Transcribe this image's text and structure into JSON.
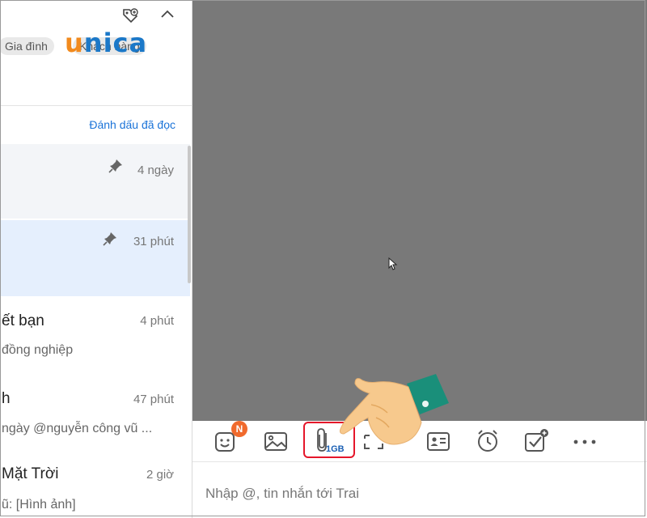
{
  "sidebar": {
    "chips": [
      "Gia đình",
      "Khách hàng"
    ],
    "logo_brand": "unica",
    "mark_read_label": "Đánh dấu đã đọc",
    "conversations": [
      {
        "name": "",
        "preview": "",
        "time": "4 ngày",
        "pinned": true
      },
      {
        "name": "",
        "preview": "",
        "time": "31 phút",
        "pinned": true,
        "selected": true
      },
      {
        "name": "ết bạn",
        "preview": "đồng nghiệp",
        "time": "4 phút"
      },
      {
        "name": "h",
        "preview": "ngày @nguyễn công vũ ...",
        "time": "47 phút"
      },
      {
        "name": "Mặt Trời",
        "preview": "ũ: [Hình ảnh]",
        "time": "2 giờ"
      }
    ]
  },
  "toolbar": {
    "items": [
      "sticker-icon",
      "image-icon",
      "attach-file-icon",
      "screenshot-icon",
      "contact-card-icon",
      "reminder-icon",
      "todo-icon",
      "more-icon"
    ],
    "sticker_badge": "N",
    "attach_limit": "1GB"
  },
  "composer": {
    "placeholder": "Nhập @, tin nhắn tới Trai"
  },
  "colors": {
    "chat_bg": "#797979",
    "selected_row": "#e5effd",
    "link": "#1a73d8",
    "highlight_border": "#e5162a",
    "badge": "#f06a2d"
  }
}
